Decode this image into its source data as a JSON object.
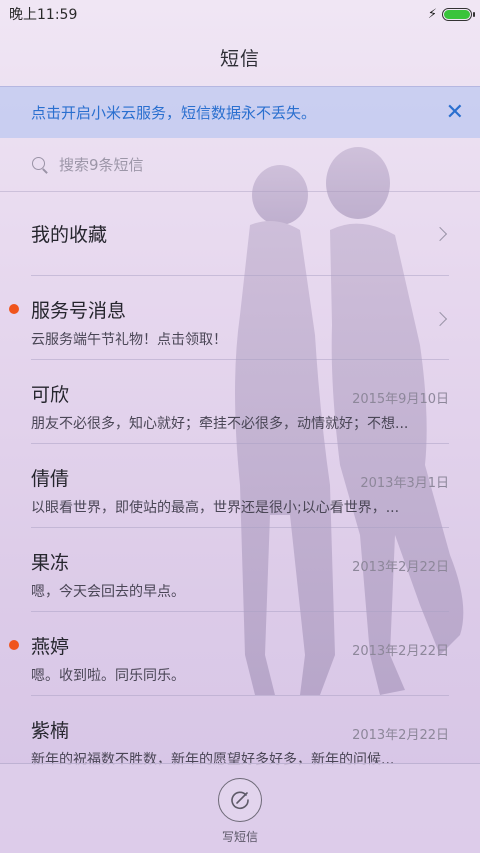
{
  "status_bar": {
    "time": "晚上11:59",
    "charging_icon": "bolt-icon",
    "battery_level": 100
  },
  "header": {
    "title": "短信"
  },
  "banner": {
    "text": "点击开启小米云服务，短信数据永不丢失。",
    "close_icon": "close-icon"
  },
  "search": {
    "placeholder": "搜索9条短信"
  },
  "favorites": {
    "label": "我的收藏"
  },
  "threads": [
    {
      "name": "服务号消息",
      "date": "",
      "preview": "云服务端午节礼物！点击领取！",
      "unread": true,
      "chevron": true
    },
    {
      "name": "可欣",
      "date": "2015年9月10日",
      "preview": "朋友不必很多，知心就好；牵挂不必很多，动情就好；不想...",
      "unread": false
    },
    {
      "name": "倩倩",
      "date": "2013年3月1日",
      "preview": "以眼看世界，即使站的最高，世界还是很小;以心看世界，...",
      "unread": false
    },
    {
      "name": "果冻",
      "date": "2013年2月22日",
      "preview": "嗯，今天会回去的早点。",
      "unread": false
    },
    {
      "name": "燕婷",
      "date": "2013年2月22日",
      "preview": "嗯。收到啦。同乐同乐。",
      "unread": true
    },
    {
      "name": "紫楠",
      "date": "2013年2月22日",
      "preview": "新年的祝福数不胜数，新年的愿望好多好多，新年的问候...",
      "unread": false
    }
  ],
  "compose": {
    "label": "写短信",
    "icon": "compose-icon"
  },
  "colors": {
    "accent": "#2a6fcf",
    "unread": "#f0541c",
    "battery": "#39c43b"
  }
}
